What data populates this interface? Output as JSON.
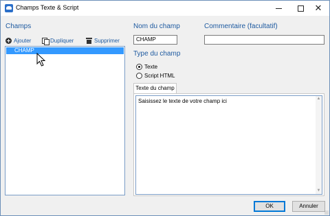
{
  "window": {
    "title": "Champs Texte & Script",
    "accent_color": "#1e5aa0",
    "selection_color": "#3399ff",
    "controls": {
      "minimize_icon": "minimize-icon",
      "maximize_icon": "maximize-icon",
      "close_icon": "close-icon"
    }
  },
  "left": {
    "heading": "Champs",
    "toolbar": [
      {
        "label": "Ajouter",
        "icon": "add-circle-icon"
      },
      {
        "label": "Dupliquer",
        "icon": "duplicate-icon"
      },
      {
        "label": "Supprimer",
        "icon": "trash-icon"
      }
    ],
    "list": [
      {
        "label": "CHAMP",
        "selected": true
      }
    ]
  },
  "right": {
    "name": {
      "label": "Nom du champ",
      "value": "CHAMP"
    },
    "comment": {
      "label": "Commentaire (facultatif)",
      "value": ""
    },
    "type": {
      "label": "Type du champ",
      "options": [
        {
          "label": "Texte",
          "checked": true
        },
        {
          "label": "Script HTML",
          "checked": false
        }
      ]
    },
    "tab": {
      "label": "Texte du champ"
    },
    "editor": {
      "value": "Saisissez le texte de votre champ ici"
    }
  },
  "footer": {
    "ok_label": "OK",
    "cancel_label": "Annuler"
  }
}
